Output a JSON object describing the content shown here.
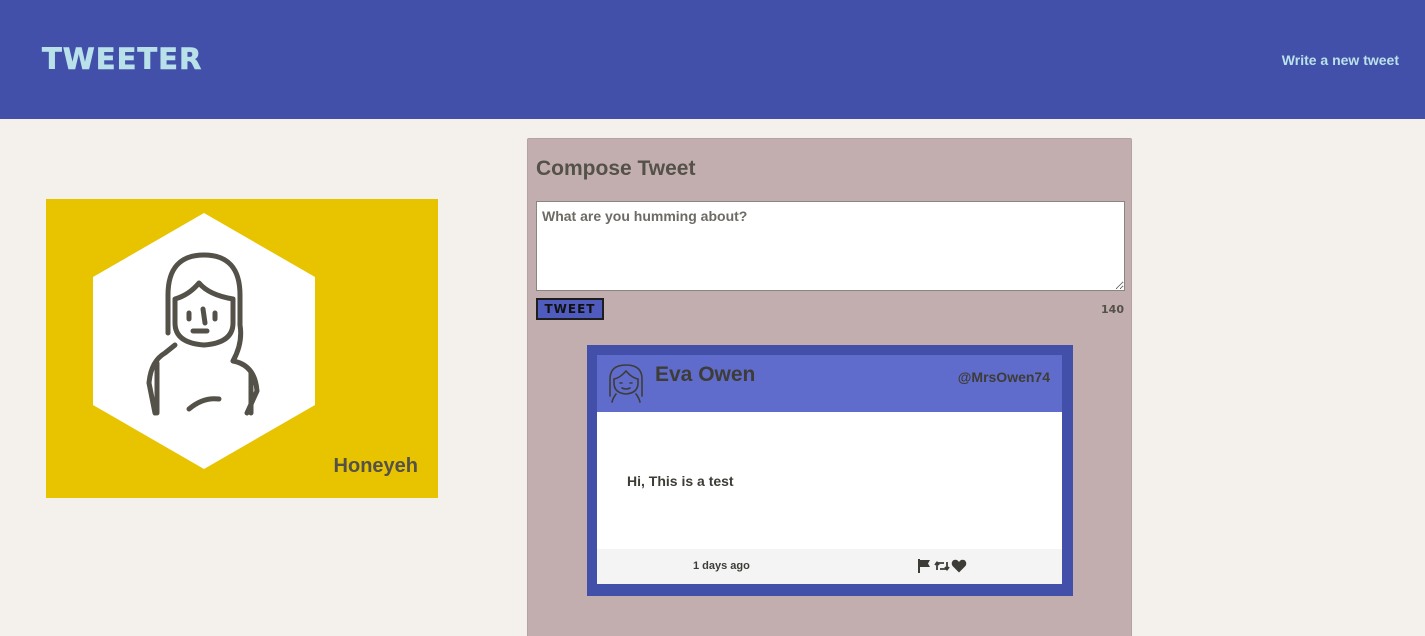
{
  "nav": {
    "brand": "TWEETER",
    "write_link": "Write a new tweet"
  },
  "profile": {
    "name": "Honeyeh",
    "background_color": "#e8c300"
  },
  "compose": {
    "title": "Compose Tweet",
    "placeholder": "What are you humming about?",
    "value": "",
    "button_label": "TWEET",
    "counter": "140"
  },
  "tweets": [
    {
      "name": "Eva Owen",
      "handle": "@MrsOwen74",
      "content": "Hi, This is a test",
      "timestamp": "1 days ago",
      "actions": [
        "flag-icon",
        "retweet-icon",
        "heart-icon"
      ]
    }
  ],
  "colors": {
    "nav": "#4350a9",
    "brand": "#b9e1ea",
    "page": "#f4f1ec",
    "compose_panel": "#c2aeaf",
    "tweet_border": "#4350a9",
    "tweet_header": "#5f6ccc",
    "button": "#4f5bbd"
  }
}
